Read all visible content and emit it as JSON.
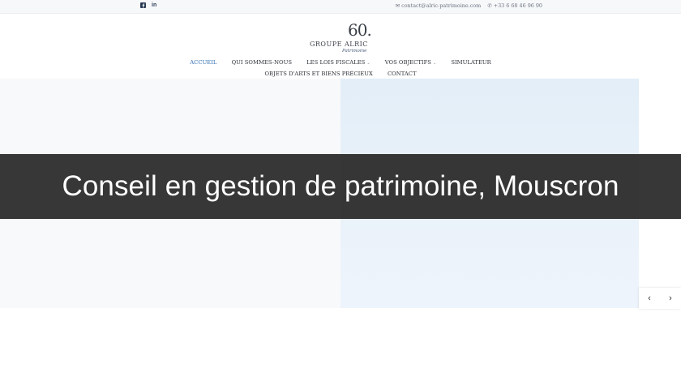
{
  "topbar": {
    "social": [
      {
        "icon": "facebook-icon",
        "glyph": "f"
      },
      {
        "icon": "linkedin-icon",
        "glyph": "in"
      }
    ],
    "email": "contact@alric-patrimoine.com",
    "phone": "+33 6 68 46 96 90",
    "email_icon": "envelope-icon",
    "phone_icon": "phone-icon"
  },
  "logo": {
    "number": "60.",
    "name": "GROUPE ALRIC",
    "sub": "Patrimoine"
  },
  "nav": {
    "row1": [
      {
        "label": "ACCUEIL",
        "active": true,
        "dropdown": false
      },
      {
        "label": "QUI SOMMES-NOUS",
        "active": false,
        "dropdown": false
      },
      {
        "label": "LES LOIS FISCALES",
        "active": false,
        "dropdown": true
      },
      {
        "label": "VOS OBJECTIFS",
        "active": false,
        "dropdown": true
      },
      {
        "label": "SIMULATEUR",
        "active": false,
        "dropdown": false
      }
    ],
    "row2": [
      {
        "label": "OBJETS D'ARTS ET BIENS PRÉCIEUX",
        "active": false,
        "dropdown": false
      },
      {
        "label": "CONTACT",
        "active": false,
        "dropdown": false
      }
    ],
    "active_color": "#2f6db0"
  },
  "banner": {
    "title": "Conseil en gestion de patrimoine, Mouscron"
  },
  "slider": {
    "prev_icon": "chevron-left-icon",
    "next_icon": "chevron-right-icon",
    "prev_glyph": "‹",
    "next_glyph": "›"
  }
}
